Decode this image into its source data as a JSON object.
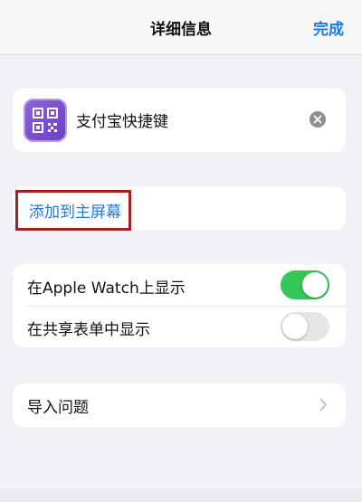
{
  "navbar": {
    "title": "详细信息",
    "done_label": "完成"
  },
  "shortcut": {
    "name": "支付宝快捷键",
    "icon": "qr-code-icon"
  },
  "add_to_home": {
    "label": "添加到主屏幕"
  },
  "toggles": [
    {
      "label": "在Apple Watch上显示",
      "on": true
    },
    {
      "label": "在共享表单中显示",
      "on": false
    }
  ],
  "import_questions": {
    "label": "导入问题"
  },
  "colors": {
    "accent": "#1a7be8",
    "toggle_on": "#34c759",
    "highlight_box": "#a51f1f",
    "icon_purple": "#7b4fd0"
  }
}
